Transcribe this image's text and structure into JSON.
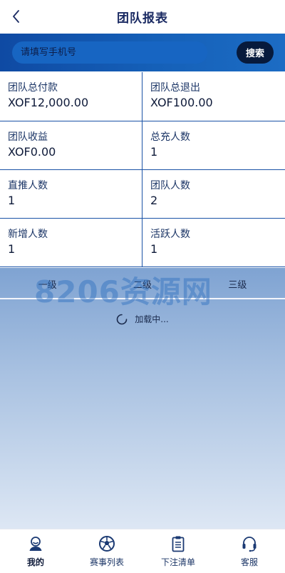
{
  "header": {
    "title": "团队报表"
  },
  "search": {
    "placeholder": "请填写手机号",
    "button_label": "搜索"
  },
  "stats": [
    {
      "label": "团队总付款",
      "value": "XOF12,000.00"
    },
    {
      "label": "团队总退出",
      "value": "XOF100.00"
    },
    {
      "label": "团队收益",
      "value": "XOF0.00"
    },
    {
      "label": "总充人数",
      "value": "1"
    },
    {
      "label": "直推人数",
      "value": "1"
    },
    {
      "label": "团队人数",
      "value": "2"
    },
    {
      "label": "新增人数",
      "value": "1"
    },
    {
      "label": "活跃人数",
      "value": "1"
    }
  ],
  "tabs": [
    "一级",
    "二级",
    "三级"
  ],
  "watermark": "8206资源网",
  "loading_text": "加载中...",
  "tabbar": [
    {
      "label": "我的",
      "icon": "user-icon",
      "active": true
    },
    {
      "label": "赛事列表",
      "icon": "soccer-ball-icon",
      "active": false
    },
    {
      "label": "下注清单",
      "icon": "clipboard-icon",
      "active": false
    },
    {
      "label": "客服",
      "icon": "headset-icon",
      "active": false
    }
  ],
  "colors": {
    "brand": "#0f4aa3",
    "dark": "#071a3c",
    "title": "#1b2b63"
  }
}
